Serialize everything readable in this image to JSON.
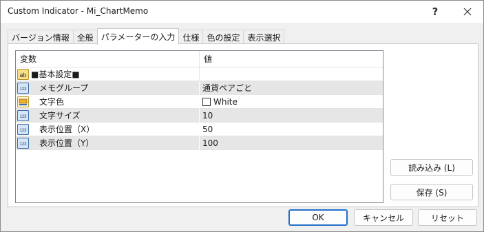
{
  "window": {
    "title": "Custom Indicator - Mi_ChartMemo",
    "help_label": "?"
  },
  "tabs": [
    {
      "label": "バージョン情報"
    },
    {
      "label": "全般"
    },
    {
      "label": "パラメーターの入力"
    },
    {
      "label": "仕様"
    },
    {
      "label": "色の設定"
    },
    {
      "label": "表示選択"
    }
  ],
  "grid": {
    "headers": [
      "変数",
      "値"
    ],
    "rows": [
      {
        "icon": "ab",
        "label": "■基本設定■",
        "value": ""
      },
      {
        "icon": "123",
        "label": "メモグループ",
        "value": "通貨ペアごと"
      },
      {
        "icon": "color",
        "label": "文字色",
        "value": "White"
      },
      {
        "icon": "123",
        "label": "文字サイズ",
        "value": "10"
      },
      {
        "icon": "123",
        "label": "表示位置（X）",
        "value": "50"
      },
      {
        "icon": "123",
        "label": "表示位置（Y）",
        "value": "100"
      }
    ]
  },
  "side_buttons": {
    "load": "読み込み (L)",
    "save": "保存 (S)"
  },
  "footer": {
    "ok": "OK",
    "cancel": "キャンセル",
    "reset": "リセット"
  },
  "colors": {
    "accent": "#1f6fc9",
    "row_shade": "#e6e6e6",
    "swatch": "#ffffff"
  }
}
